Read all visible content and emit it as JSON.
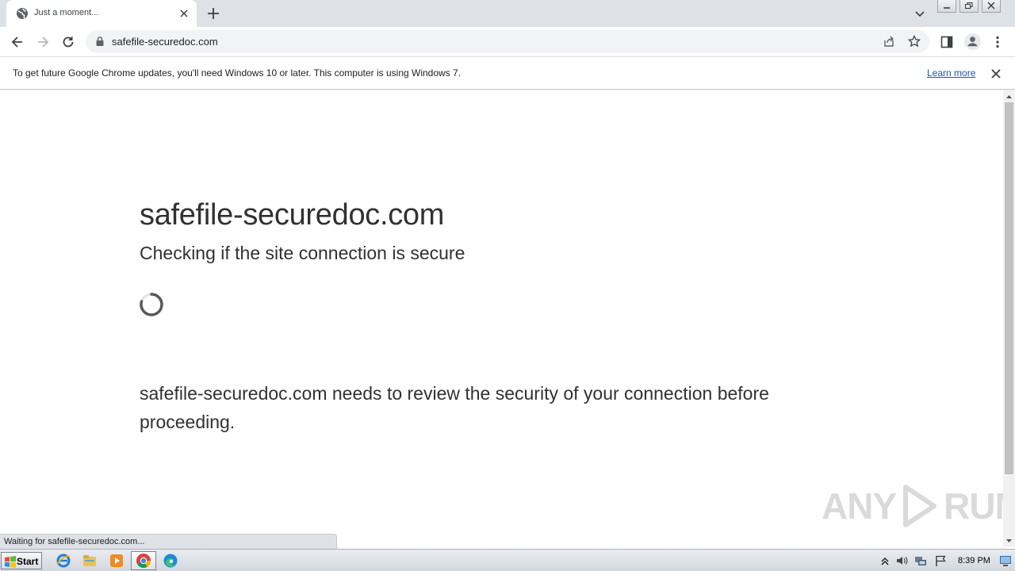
{
  "browser": {
    "tab": {
      "title": "Just a moment...",
      "favicon": "globe-icon"
    },
    "address_bar": {
      "url": "safefile-securedoc.com"
    },
    "infobar": {
      "message": "To get future Google Chrome updates, you'll need Windows 10 or later. This computer is using Windows 7.",
      "link_label": "Learn more"
    },
    "status_text": "Waiting for safefile-securedoc.com..."
  },
  "page": {
    "title": "safefile-securedoc.com",
    "subtitle": "Checking if the site connection is secure",
    "review_message": "safefile-securedoc.com needs to review the security of your connection before proceeding."
  },
  "watermark": {
    "left": "ANY",
    "right": "RUN"
  },
  "taskbar": {
    "start_label": "Start",
    "pinned_icons": [
      "internet-explorer-icon",
      "file-explorer-icon",
      "media-player-icon",
      "chrome-icon",
      "edge-icon"
    ],
    "tray_icons": [
      "show-hidden-icons-icon",
      "volume-icon",
      "network-icon",
      "action-center-flag-icon"
    ],
    "clock": "8:39 PM"
  },
  "colors": {
    "tabstrip_bg": "#dee1e6",
    "omnibox_bg": "#f1f3f4",
    "link": "#1a57c0",
    "page_text": "#313131"
  }
}
